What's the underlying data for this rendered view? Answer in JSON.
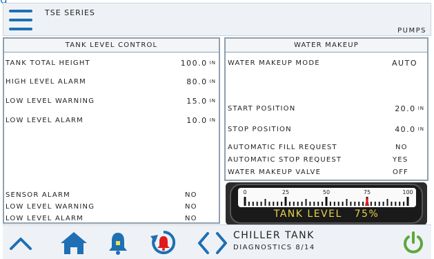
{
  "header": {
    "series": "TSE SERIES",
    "pumps_label": "PUMPS"
  },
  "tank_level_control": {
    "title": "TANK LEVEL CONTROL",
    "rows": [
      {
        "label": "TANK TOTAL HEIGHT",
        "value": "100.0",
        "unit": "IN"
      },
      {
        "label": "HIGH LEVEL ALARM",
        "value": "80.0",
        "unit": "IN"
      },
      {
        "label": "LOW LEVEL WARNING",
        "value": "15.0",
        "unit": "IN"
      },
      {
        "label": "LOW LEVEL ALARM",
        "value": "10.0",
        "unit": "IN"
      }
    ],
    "status": [
      {
        "label": "SENSOR ALARM",
        "value": "NO"
      },
      {
        "label": "LOW LEVEL WARNING",
        "value": "NO"
      },
      {
        "label": "LOW LEVEL ALARM",
        "value": "NO"
      }
    ]
  },
  "water_makeup": {
    "title": "WATER MAKEUP",
    "mode_label": "WATER MAKEUP MODE",
    "mode_value": "AUTO",
    "start_label": "START POSITION",
    "start_value": "20.0",
    "start_unit": "IN",
    "stop_label": "STOP POSITION",
    "stop_value": "40.0",
    "stop_unit": "IN",
    "status": [
      {
        "label": "AUTOMATIC FILL REQUEST",
        "value": "NO"
      },
      {
        "label": "AUTOMATIC STOP REQUEST",
        "value": "YES"
      },
      {
        "label": "WATER MAKEUP VALVE",
        "value": "OFF"
      }
    ]
  },
  "gauge": {
    "ticks": [
      "0",
      "25",
      "50",
      "75",
      "100"
    ],
    "label": "TANK LEVEL",
    "value_text": "75%",
    "value": 75,
    "needle_color": "#e01b1b"
  },
  "footer": {
    "title": "CHILLER TANK",
    "subtitle": "DIAGNOSTICS 8/14"
  },
  "colors": {
    "accent": "#1e6fb3",
    "alarm": "#e01b1b",
    "power": "#5aa83c",
    "gauge_text": "#e8d44d"
  },
  "icons": [
    "hamburger-icon",
    "chevron-up-icon",
    "home-icon",
    "bell-icon",
    "alarm-reset-icon",
    "chevron-left-icon",
    "chevron-right-icon",
    "power-icon"
  ]
}
